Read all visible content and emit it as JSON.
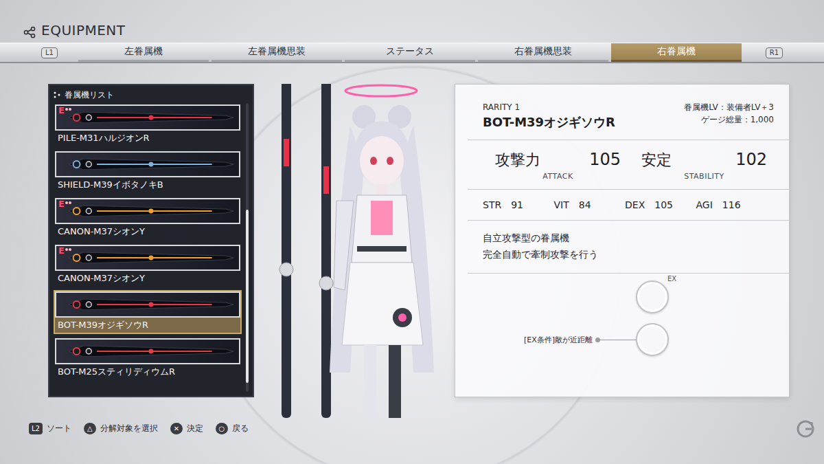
{
  "header": {
    "title": "EQUIPMENT"
  },
  "tabs": {
    "left_key": "L1",
    "right_key": "R1",
    "items": [
      {
        "label": "左眷属機",
        "selected": false
      },
      {
        "label": "左眷属機思装",
        "selected": false
      },
      {
        "label": "ステータス",
        "selected": false
      },
      {
        "label": "右眷属機思装",
        "selected": false
      },
      {
        "label": "右眷属機",
        "selected": true
      }
    ]
  },
  "list": {
    "title": "眷属機リスト",
    "equipped_badge": "E",
    "scrollbar": {
      "position": 0.37,
      "size": 0.6
    },
    "items": [
      {
        "name": "PILE-M31ハルジオンR",
        "equipped": true,
        "selected": false,
        "color": "#e8324a"
      },
      {
        "name": "SHIELD-M39イボタノキB",
        "equipped": false,
        "selected": false,
        "color": "#7fb4e0"
      },
      {
        "name": "CANON-M37シオンY",
        "equipped": true,
        "selected": false,
        "color": "#f0a030"
      },
      {
        "name": "CANON-M37シオンY",
        "equipped": true,
        "selected": false,
        "color": "#f0a030"
      },
      {
        "name": "BOT-M39オジギソウR",
        "equipped": false,
        "selected": true,
        "color": "#e83848"
      },
      {
        "name": "BOT-M25スティリディウムR",
        "equipped": false,
        "selected": false,
        "color": "#e04040"
      }
    ]
  },
  "detail": {
    "rarity": "RARITY 1",
    "name": "BOT-M39オジギソウR",
    "level_rule": "眷属機LV：装備者LV＋3",
    "gauge": "ゲージ総量：1,000",
    "main_stats": [
      {
        "label": "攻撃力",
        "value": "105",
        "sub": "ATTACK"
      },
      {
        "label": "安定",
        "value": "102",
        "sub": "STABILITY"
      }
    ],
    "stats": [
      {
        "label": "STR",
        "value": "91"
      },
      {
        "label": "VIT",
        "value": "84"
      },
      {
        "label": "DEX",
        "value": "105"
      },
      {
        "label": "AGI",
        "value": "116"
      }
    ],
    "description": [
      "自立攻撃型の眷属機",
      "完全自動で牽制攻撃を行う"
    ],
    "ex": {
      "label": "EX",
      "condition": "[EX条件]敵が近距離"
    }
  },
  "footer": {
    "hints": [
      {
        "key": "L2",
        "kind": "trigger",
        "label": "ソート"
      },
      {
        "key": "△",
        "kind": "button",
        "label": "分解対象を選択"
      },
      {
        "key": "✕",
        "kind": "button",
        "label": "決定"
      },
      {
        "key": "○",
        "kind": "button",
        "label": "戻る"
      }
    ]
  }
}
